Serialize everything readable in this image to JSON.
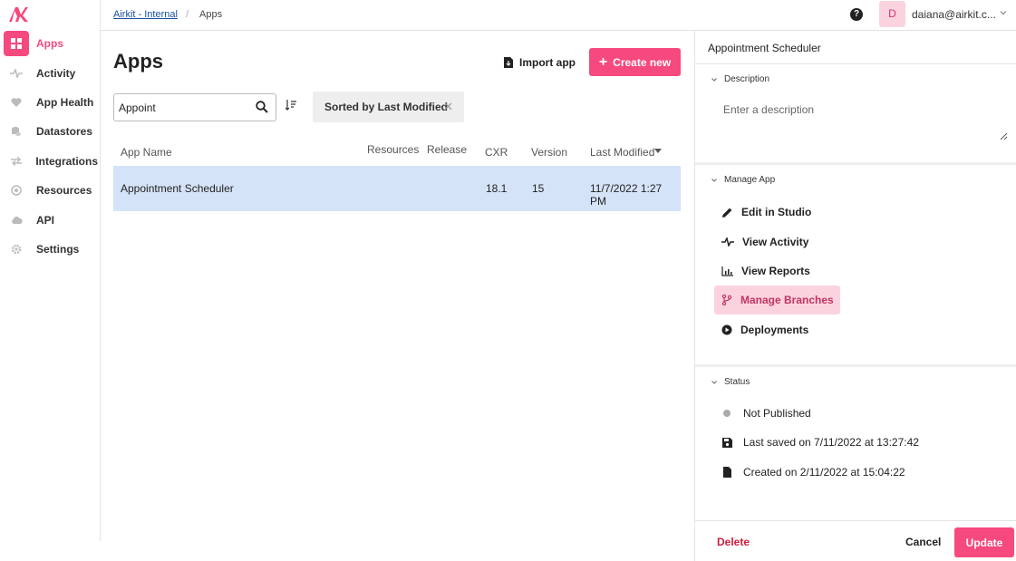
{
  "sidebar": {
    "items": [
      {
        "label": "Apps",
        "icon": "apps-icon",
        "active": true
      },
      {
        "label": "Activity",
        "icon": "activity-icon"
      },
      {
        "label": "App Health",
        "icon": "heart-icon"
      },
      {
        "label": "Datastores",
        "icon": "datastore-icon"
      },
      {
        "label": "Integrations",
        "icon": "integrations-icon"
      },
      {
        "label": "Resources",
        "icon": "resources-icon"
      },
      {
        "label": "API",
        "icon": "cloud-icon"
      },
      {
        "label": "Settings",
        "icon": "gear-icon"
      }
    ]
  },
  "breadcrumb": {
    "parent": "Airkit - Internal",
    "separator": "/",
    "current": "Apps"
  },
  "user": {
    "initial": "D",
    "email": "daiana@airkit.c..."
  },
  "main": {
    "title": "Apps",
    "import_label": "Import app",
    "create_label": "Create new",
    "search": {
      "value": "Appoint",
      "placeholder": ""
    },
    "sort_chip": "Sorted by Last Modified",
    "table": {
      "columns": {
        "name": "App Name",
        "resources": "Resources",
        "release": "Release",
        "cxr": "CXR",
        "version": "Version",
        "modified": "Last Modified"
      },
      "rows": [
        {
          "name": "Appointment Scheduler",
          "resources": "",
          "release": "",
          "cxr": "18.1",
          "version": "15",
          "modified": "11/7/2022 1:27 PM"
        }
      ]
    }
  },
  "panel": {
    "title": "Appointment Scheduler",
    "description": {
      "heading": "Description",
      "placeholder": "Enter a description"
    },
    "manage": {
      "heading": "Manage App",
      "items": [
        {
          "label": "Edit in Studio",
          "icon": "pencil-icon"
        },
        {
          "label": "View Activity",
          "icon": "activity-icon"
        },
        {
          "label": "View Reports",
          "icon": "chart-icon"
        },
        {
          "label": "Manage Branches",
          "icon": "branch-icon",
          "active": true
        },
        {
          "label": "Deployments",
          "icon": "play-icon"
        }
      ]
    },
    "status": {
      "heading": "Status",
      "items": [
        {
          "label": "Not Published",
          "icon": "dot-icon"
        },
        {
          "label": "Last saved on 7/11/2022 at 13:27:42",
          "icon": "save-icon"
        },
        {
          "label": "Created on 2/11/2022 at 15:04:22",
          "icon": "file-icon"
        }
      ]
    },
    "footer": {
      "delete": "Delete",
      "cancel": "Cancel",
      "update": "Update"
    }
  },
  "colors": {
    "accent": "#f6497d",
    "selected_row": "#d4e3f8",
    "active_menu_bg": "#fbd3df",
    "danger": "#d01c3c"
  }
}
